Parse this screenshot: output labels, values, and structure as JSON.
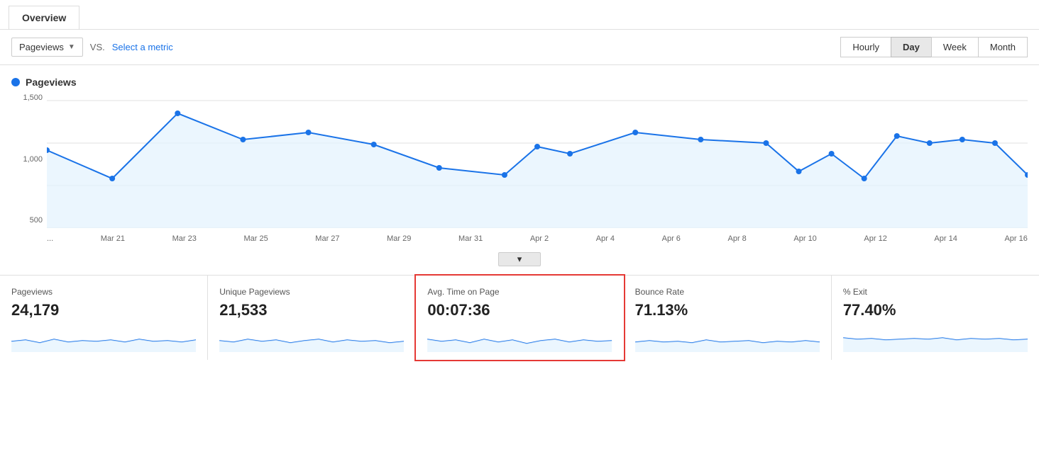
{
  "tab": {
    "label": "Overview"
  },
  "toolbar": {
    "metric_label": "Pageviews",
    "vs_label": "VS.",
    "select_metric_label": "Select a metric",
    "time_buttons": [
      {
        "label": "Hourly",
        "active": false
      },
      {
        "label": "Day",
        "active": true
      },
      {
        "label": "Week",
        "active": false
      },
      {
        "label": "Month",
        "active": false
      }
    ]
  },
  "chart": {
    "legend_label": "Pageviews",
    "y_labels": [
      "1,500",
      "1,000",
      "500"
    ],
    "x_labels": [
      "...",
      "Mar 21",
      "Mar 23",
      "Mar 25",
      "Mar 27",
      "Mar 29",
      "Mar 31",
      "Apr 2",
      "Apr 4",
      "Apr 6",
      "Apr 8",
      "Apr 10",
      "Apr 12",
      "Apr 14",
      "Apr 16"
    ]
  },
  "metrics": [
    {
      "title": "Pageviews",
      "value": "24,179",
      "highlighted": false
    },
    {
      "title": "Unique Pageviews",
      "value": "21,533",
      "highlighted": false
    },
    {
      "title": "Avg. Time on Page",
      "value": "00:07:36",
      "highlighted": true
    },
    {
      "title": "Bounce Rate",
      "value": "71.13%",
      "highlighted": false
    },
    {
      "title": "% Exit",
      "value": "77.40%",
      "highlighted": false
    }
  ]
}
